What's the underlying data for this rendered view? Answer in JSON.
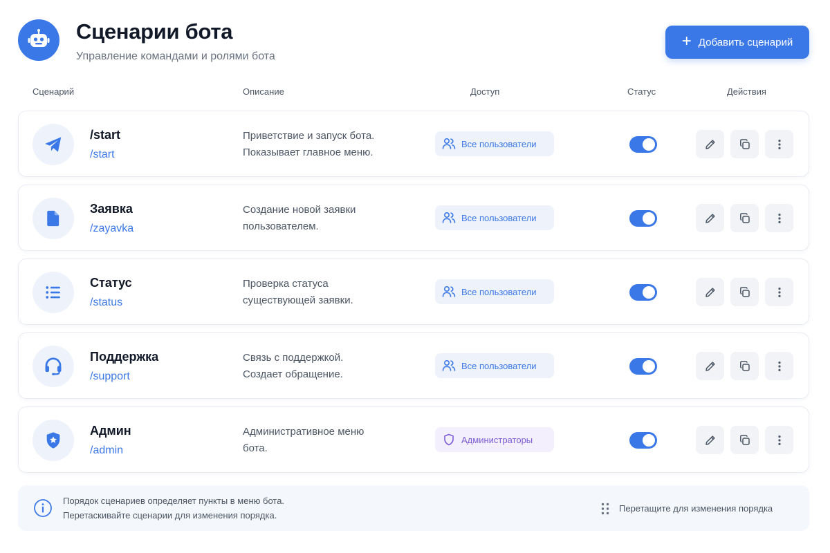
{
  "header": {
    "title": "Сценарии бота",
    "subtitle": "Управление командами и ролями бота",
    "add_button": "Добавить сценарий",
    "logo_icon": "robot-icon"
  },
  "columns": {
    "scenario": "Сценарий",
    "description": "Описание",
    "access": "Доступ",
    "status": "Статус",
    "actions": "Действия"
  },
  "scenarios": [
    {
      "name": "/start",
      "command": "/start",
      "description_line1": "Приветствие и запуск бота.",
      "description_line2": "Показывает главное меню.",
      "access": "Все пользователи",
      "enabled": true,
      "icon": "paper-plane-icon"
    },
    {
      "name": "Заявка",
      "command": "/zayavka",
      "description_line1": "Создание новой заявки",
      "description_line2": "пользователем.",
      "access": "Все пользователи",
      "enabled": true,
      "icon": "document-icon"
    },
    {
      "name": "Статус",
      "command": "/status",
      "description_line1": "Проверка статуса",
      "description_line2": "существующей заявки.",
      "access": "Все пользователи",
      "enabled": true,
      "icon": "list-icon"
    },
    {
      "name": "Поддержка",
      "command": "/support",
      "description_line1": "Связь с поддержкой.",
      "description_line2": "Создает обращение.",
      "access": "Все пользователи",
      "enabled": true,
      "icon": "headset-icon"
    },
    {
      "name": "Админ",
      "command": "/admin",
      "description_line1": "Административное меню",
      "description_line2": "бота.",
      "access": "Администраторы",
      "enabled": true,
      "icon": "shield-star-icon"
    }
  ],
  "footer": {
    "line1": "Порядок сценариев определяет пункты в меню бота.",
    "line2": "Перетаскивайте сценарии для изменения порядка.",
    "drag_hint": "Перетащите для изменения порядка"
  },
  "colors": {
    "accent": "#3b78e7",
    "admin_badge": "#7c5cd6"
  }
}
